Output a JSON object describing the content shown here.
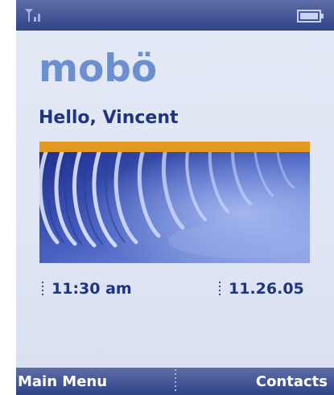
{
  "status_bar": {
    "signal_icon": "signal-strength-icon",
    "battery_icon": "battery-icon"
  },
  "brand": {
    "logo_text": "mobö"
  },
  "home": {
    "greeting": "Hello, Vincent",
    "time": "11:30 am",
    "date": "11.26.05"
  },
  "softkeys": {
    "left_label": "Main Menu",
    "right_label": "Contacts"
  },
  "colors": {
    "logo": "#6c8fcf",
    "text": "#1f3582",
    "accent_bar": "#e19a1f",
    "bar_background": "#3a4c8f"
  }
}
